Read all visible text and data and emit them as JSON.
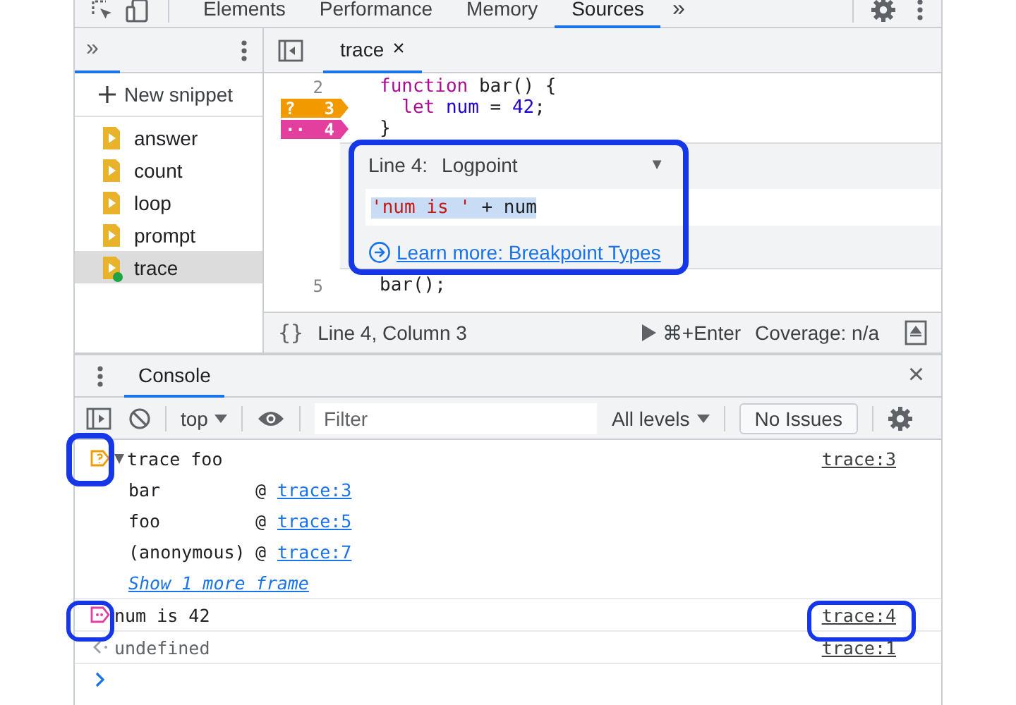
{
  "main_tabs": [
    {
      "label": "Elements",
      "selected": false
    },
    {
      "label": "Performance",
      "selected": false
    },
    {
      "label": "Memory",
      "selected": false
    },
    {
      "label": "Sources",
      "selected": true
    }
  ],
  "more_tabs": "»",
  "navigator": {
    "more": "»",
    "new_snippet": "New snippet",
    "snippets": [
      {
        "name": "answer",
        "selected": false,
        "running": false
      },
      {
        "name": "count",
        "selected": false,
        "running": false
      },
      {
        "name": "loop",
        "selected": false,
        "running": false
      },
      {
        "name": "prompt",
        "selected": false,
        "running": false
      },
      {
        "name": "trace",
        "selected": true,
        "running": true
      }
    ]
  },
  "editor": {
    "tab": {
      "label": "trace",
      "close": "×"
    },
    "lines": [
      {
        "number": "2",
        "kind": "plain",
        "tokens": [
          {
            "text": "function",
            "kind": "keyword"
          },
          {
            "text": " bar() {",
            "kind": "plain"
          }
        ]
      },
      {
        "number": "3",
        "kind": "conditional",
        "marker_label": "?",
        "tokens": [
          {
            "text": "  let",
            "kind": "keyword"
          },
          {
            "text": " num",
            "kind": "variable"
          },
          {
            "text": " = ",
            "kind": "plain"
          },
          {
            "text": "42",
            "kind": "number"
          },
          {
            "text": ";",
            "kind": "plain"
          }
        ]
      },
      {
        "number": "4",
        "kind": "logpoint",
        "marker_label": "··",
        "tokens": [
          {
            "text": "}",
            "kind": "plain"
          }
        ]
      }
    ],
    "logpoint": {
      "line_label": "Line 4:",
      "type": "Logpoint",
      "dropdown": "▼",
      "expression": [
        {
          "text": "'num is '",
          "kind": "string"
        },
        {
          "text": " + num",
          "kind": "plain"
        }
      ],
      "link": "Learn more: Breakpoint Types"
    },
    "after_lines": [
      {
        "number": "5",
        "kind": "plain",
        "tokens": [
          {
            "text": "bar();",
            "kind": "plain"
          }
        ]
      }
    ],
    "footer": {
      "format": "{}",
      "position": "Line 4, Column 3",
      "run": "⌘+Enter",
      "coverage": "Coverage: n/a"
    }
  },
  "console": {
    "tab": "Console",
    "close": "×",
    "context": "top",
    "filter_placeholder": "Filter",
    "levels": "All levels",
    "issues": "No Issues",
    "messages": [
      {
        "kind": "trace",
        "text": "trace foo",
        "source": "trace:3",
        "expanded": true,
        "more": "Show 1 more frame",
        "frames": [
          {
            "function": "bar",
            "at": "@",
            "location": "trace:3"
          },
          {
            "function": "foo",
            "at": "@",
            "location": "trace:5"
          },
          {
            "function": "(anonymous)",
            "at": "@",
            "location": "trace:7"
          }
        ]
      },
      {
        "kind": "log",
        "text": "num is 42",
        "source": "trace:4"
      },
      {
        "kind": "result",
        "text": "undefined",
        "source": "trace:1"
      }
    ]
  }
}
